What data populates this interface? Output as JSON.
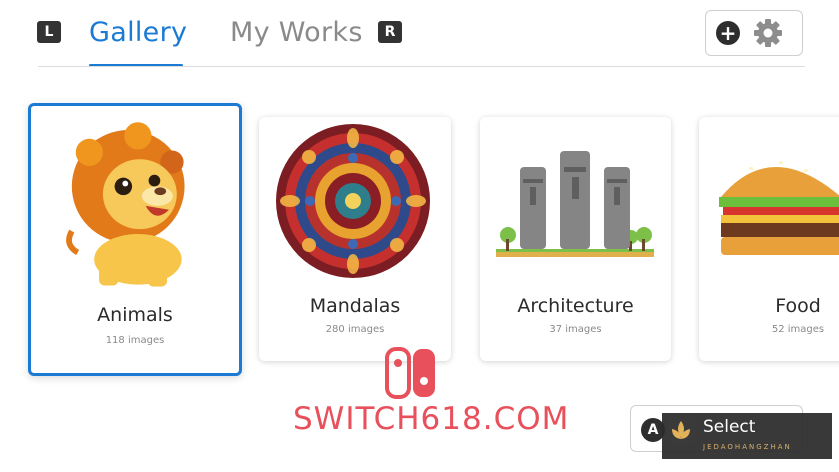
{
  "header": {
    "left_button_glyph": "L",
    "right_button_glyph": "R",
    "tabs": [
      {
        "label": "Gallery",
        "active": true
      },
      {
        "label": "My Works",
        "active": false
      }
    ],
    "actions": [
      {
        "icon": "plus-circle-icon"
      },
      {
        "icon": "gear-icon"
      }
    ]
  },
  "categories": [
    {
      "title": "Animals",
      "count": "118 images",
      "selected": true
    },
    {
      "title": "Mandalas",
      "count": "280 images",
      "selected": false
    },
    {
      "title": "Architecture",
      "count": "37 images",
      "selected": false
    },
    {
      "title": "Food",
      "count": "52 images",
      "selected": false
    }
  ],
  "watermark": {
    "text": "SWITCH618.COM"
  },
  "footer": {
    "button_glyph": "A",
    "select_label": "Select",
    "overlay_sub": "JEDAOHANGZHAN"
  },
  "colors": {
    "accent": "#1b7bd4",
    "inactive_tab": "#8a8a8a",
    "watermark": "#e8505b"
  }
}
